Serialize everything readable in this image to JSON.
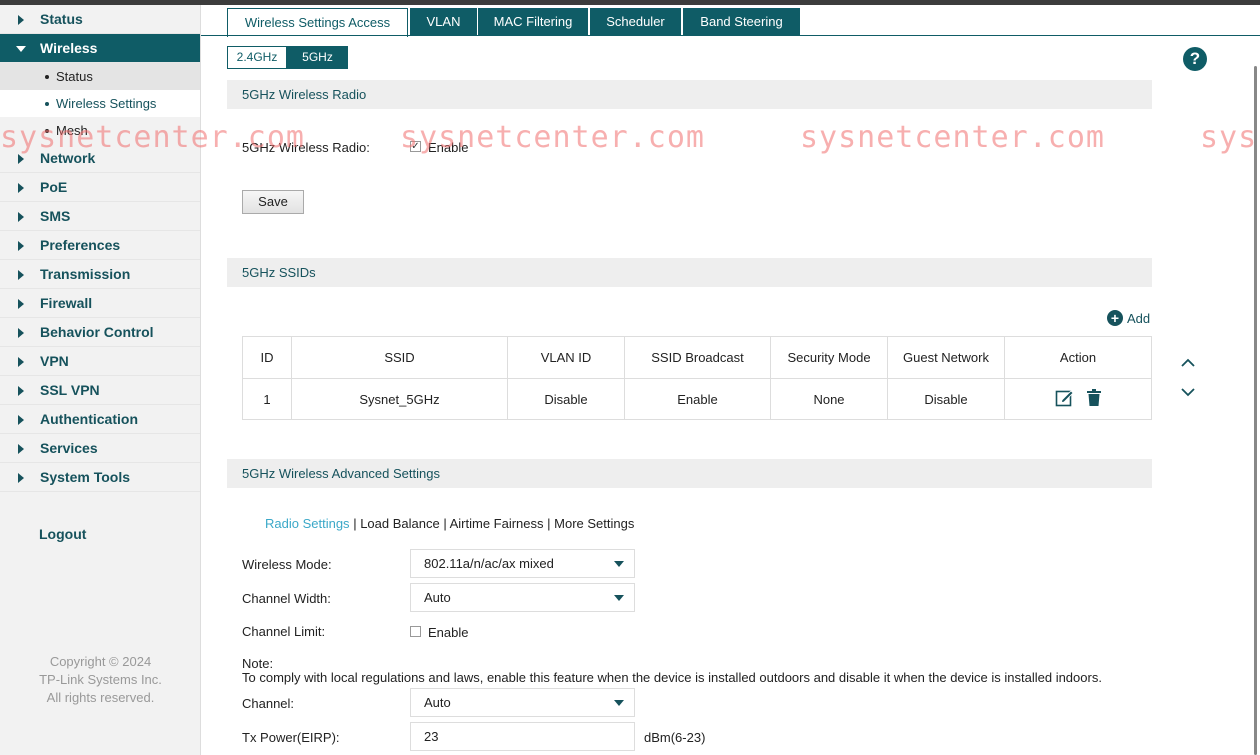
{
  "sidebar": {
    "items": [
      {
        "label": "Status"
      },
      {
        "label": "Wireless"
      },
      {
        "label": "Network"
      },
      {
        "label": "PoE"
      },
      {
        "label": "SMS"
      },
      {
        "label": "Preferences"
      },
      {
        "label": "Transmission"
      },
      {
        "label": "Firewall"
      },
      {
        "label": "Behavior Control"
      },
      {
        "label": "VPN"
      },
      {
        "label": "SSL VPN"
      },
      {
        "label": "Authentication"
      },
      {
        "label": "Services"
      },
      {
        "label": "System Tools"
      }
    ],
    "wireless_sub": [
      {
        "label": "Status"
      },
      {
        "label": "Wireless Settings"
      },
      {
        "label": "Mesh"
      }
    ],
    "logout": "Logout",
    "copyright": [
      "Copyright © 2024",
      "TP-Link Systems Inc.",
      "All rights reserved."
    ]
  },
  "tabs": [
    "Wireless Settings Access",
    "VLAN",
    "MAC Filtering",
    "Scheduler",
    "Band Steering"
  ],
  "bands": [
    "2.4GHz",
    "5GHz"
  ],
  "help": "?",
  "radio_section": {
    "title": "5GHz Wireless Radio",
    "label": "5GHz Wireless Radio:",
    "enable_label": "Enable",
    "enabled": true,
    "save": "Save"
  },
  "ssid_section": {
    "title": "5GHz SSIDs",
    "add": "Add",
    "headers": [
      "ID",
      "SSID",
      "VLAN ID",
      "SSID Broadcast",
      "Security Mode",
      "Guest Network",
      "Action"
    ],
    "rows": [
      {
        "id": "1",
        "ssid": "Sysnet_5GHz",
        "vlan": "Disable",
        "broadcast": "Enable",
        "security": "None",
        "guest": "Disable"
      }
    ]
  },
  "advanced_section": {
    "title": "5GHz Wireless Advanced Settings",
    "subnav": [
      "Radio Settings",
      "Load Balance",
      "Airtime Fairness",
      "More Settings"
    ],
    "wireless_mode_label": "Wireless Mode:",
    "wireless_mode": "802.11a/n/ac/ax mixed",
    "channel_width_label": "Channel Width:",
    "channel_width": "Auto",
    "channel_limit_label": "Channel Limit:",
    "channel_limit_enable": "Enable",
    "note_title": "Note:",
    "note_text": "To comply with local regulations and laws, enable this feature when the device is installed outdoors and disable it when the device is installed indoors.",
    "channel_label": "Channel:",
    "channel": "Auto",
    "tx_power_label": "Tx Power(EIRP):",
    "tx_power": "23",
    "tx_power_unit": "dBm(6-23)"
  },
  "watermark": "sysnetcenter.com",
  "colors": {
    "accent": "#0f5c66",
    "link_active": "#3ba8c8",
    "watermark": "#f06e6e"
  }
}
